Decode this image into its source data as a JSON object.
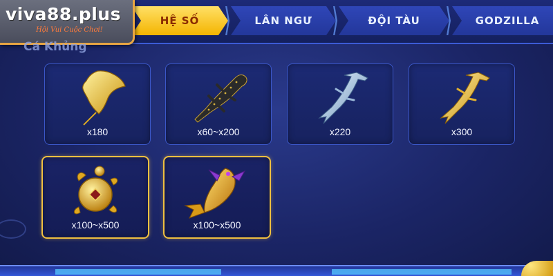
{
  "logo": {
    "text": "viva88.plus",
    "slogan": "Hội Vui Cuộc Chơi!"
  },
  "tabs": [
    {
      "label": "HỆ SỐ",
      "active": true
    },
    {
      "label": "LÂN NGƯ",
      "active": false
    },
    {
      "label": "ĐỘI TÀU",
      "active": false
    },
    {
      "label": "GODZILLA",
      "active": false
    }
  ],
  "section": {
    "title": "Cá Khủng"
  },
  "cards": [
    {
      "creature": "golden-manta-ray",
      "multiplier": "x180",
      "highlight": false
    },
    {
      "creature": "black-crocodile",
      "multiplier": "x60~x200",
      "highlight": false
    },
    {
      "creature": "silver-hammerhead-shark",
      "multiplier": "x220",
      "highlight": false
    },
    {
      "creature": "golden-hammerhead-shark",
      "multiplier": "x300",
      "highlight": false
    },
    {
      "creature": "golden-turtle",
      "multiplier": "x100~x500",
      "highlight": true
    },
    {
      "creature": "golden-armored-fish",
      "multiplier": "x100~x500",
      "highlight": true
    }
  ],
  "colors": {
    "active_tab": "#f4b400",
    "tab": "#2f46b8",
    "card_border": "#3b57c8",
    "highlight_border": "#f0c040",
    "logo_accent": "#e9a642"
  }
}
